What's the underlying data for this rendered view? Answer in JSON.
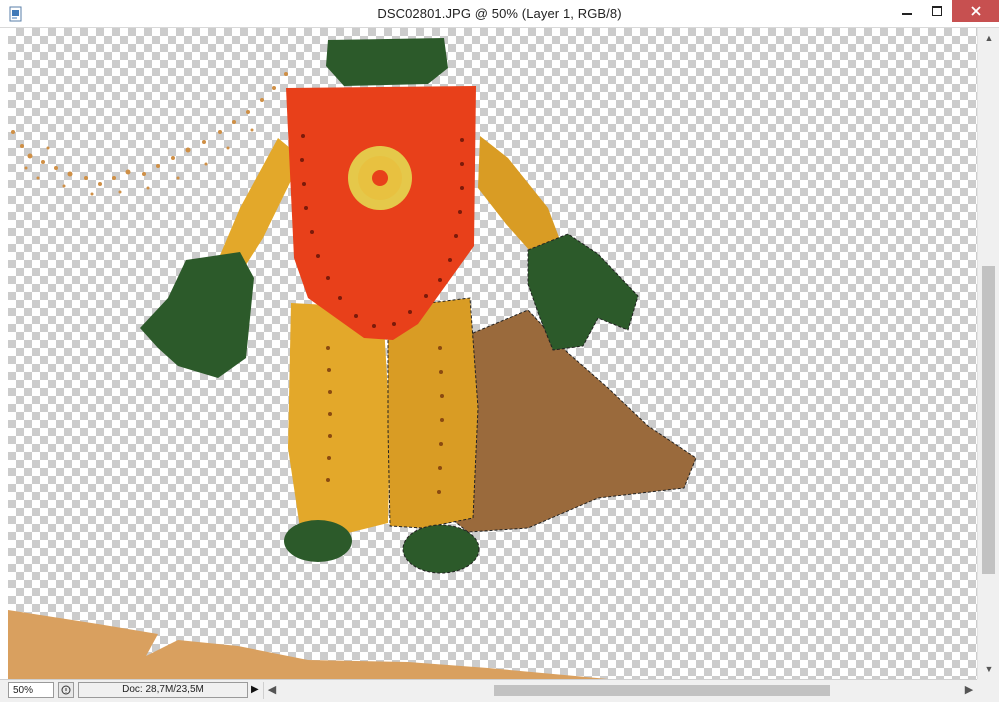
{
  "window": {
    "title": "DSC02801.JPG @ 50% (Layer 1, RGB/8)",
    "icons": {
      "app": "photoshop-document-icon",
      "minimize": "minimize-icon",
      "maximize": "maximize-icon",
      "close": "close-icon"
    },
    "close_color": "#c75050"
  },
  "canvas": {
    "background": "transparency-checkerboard",
    "subject": "clay-figure",
    "colors": {
      "body": "#e3a82a",
      "vest": "#e8401a",
      "hands": "#2c5a2a",
      "shadow": "#9a6a3c",
      "table": "#d9a05f"
    }
  },
  "statusbar": {
    "zoom": "50%",
    "doc_info": "Doc: 28,7M/23,5M",
    "icons": {
      "info": "status-info-icon",
      "menu": "play-arrow-icon"
    }
  },
  "scrollbars": {
    "vertical": {
      "up": "▲",
      "down": "▼"
    },
    "horizontal": {
      "left": "◀",
      "right": "▶"
    }
  }
}
